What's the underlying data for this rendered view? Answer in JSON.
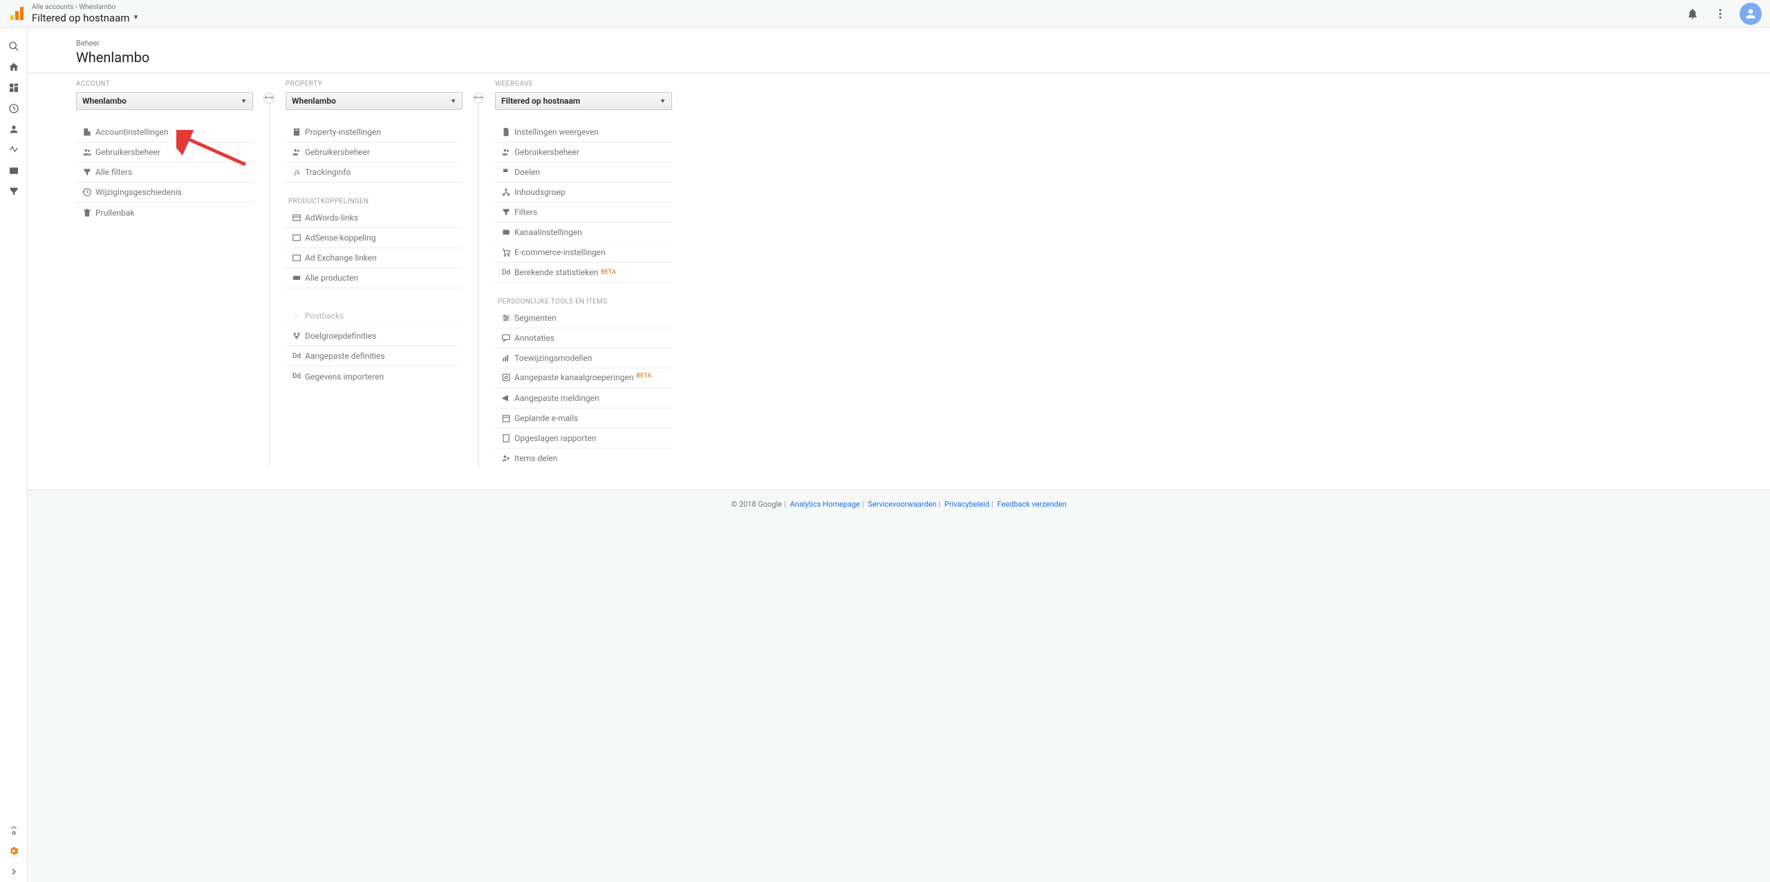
{
  "header": {
    "breadcrumb_l1": "Alle accounts",
    "breadcrumb_l2": "Whenlambo",
    "title": "Filtered op hostnaam"
  },
  "page": {
    "crumb": "Beheer",
    "title": "Whenlambo"
  },
  "columns": {
    "account": {
      "label": "ACCOUNT",
      "selector": "Whenlambo",
      "items": [
        {
          "label": "Accountinstellingen"
        },
        {
          "label": "Gebruikersbeheer"
        },
        {
          "label": "Alle filters"
        },
        {
          "label": "Wijzigingsgeschiedenis"
        },
        {
          "label": "Prullenbak"
        }
      ]
    },
    "property": {
      "label": "PROPERTY",
      "selector": "Whenlambo",
      "items": [
        {
          "label": "Property-instellingen"
        },
        {
          "label": "Gebruikersbeheer"
        },
        {
          "label": "Trackinginfo"
        }
      ],
      "section1_label": "PRODUCTKOPPELINGEN",
      "section1": [
        {
          "label": "AdWords-links"
        },
        {
          "label": "AdSense-koppeling"
        },
        {
          "label": "Ad Exchange linken"
        },
        {
          "label": "Alle producten"
        }
      ],
      "section2": [
        {
          "label": "Postbacks"
        },
        {
          "label": "Doelgroepdefinities"
        },
        {
          "label": "Aangepaste definities"
        },
        {
          "label": "Gegevens importeren"
        }
      ]
    },
    "view": {
      "label": "WEERGAVE",
      "selector": "Filtered op hostnaam",
      "items": [
        {
          "label": "Instellingen weergeven"
        },
        {
          "label": "Gebruikersbeheer"
        },
        {
          "label": "Doelen"
        },
        {
          "label": "Inhoudsgroep"
        },
        {
          "label": "Filters"
        },
        {
          "label": "Kanaalinstellingen"
        },
        {
          "label": "E-commerce-instellingen"
        },
        {
          "label": "Berekende statistieken",
          "beta": "BETA"
        }
      ],
      "section1_label": "PERSOONLIJKE TOOLS EN ITEMS",
      "section1": [
        {
          "label": "Segmenten"
        },
        {
          "label": "Annotaties"
        },
        {
          "label": "Toewijzingsmodellen"
        },
        {
          "label": "Aangepaste kanaalgroeperingen",
          "beta": "BETA"
        },
        {
          "label": "Aangepaste meldingen"
        },
        {
          "label": "Geplande e-mails"
        },
        {
          "label": "Opgeslagen rapporten"
        },
        {
          "label": "Items delen"
        }
      ]
    }
  },
  "footer": {
    "copyright": "© 2018 Google",
    "links": [
      "Analytics Homepage",
      "Servicevoorwaarden",
      "Privacybeleid",
      "Feedback verzenden"
    ]
  }
}
